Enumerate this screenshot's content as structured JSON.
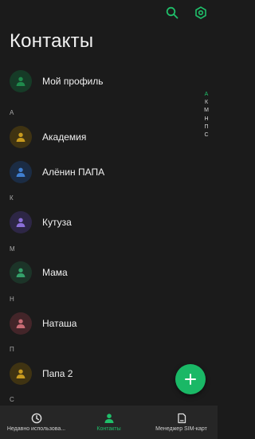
{
  "header": {
    "title": "Контакты",
    "icons": [
      "search-icon",
      "settings-icon"
    ]
  },
  "colors": {
    "accent": "#1fbf6a",
    "background": "#1b1b1b",
    "nav_background": "#262626"
  },
  "my_profile": {
    "label": "Мой профиль",
    "avatar_color": "#1f8a4c",
    "avatar_bg": "#163b27"
  },
  "sections": [
    {
      "letter": "А",
      "contacts": [
        {
          "name": "Академия",
          "avatar_color": "#c79a1e",
          "avatar_bg": "#3f3312"
        },
        {
          "name": "Алёнин ПАПА",
          "avatar_color": "#3f7fd0",
          "avatar_bg": "#1b2c44"
        }
      ]
    },
    {
      "letter": "К",
      "contacts": [
        {
          "name": "Кутуза",
          "avatar_color": "#8b6fd8",
          "avatar_bg": "#2d2645"
        }
      ]
    },
    {
      "letter": "М",
      "contacts": [
        {
          "name": "Мама",
          "avatar_color": "#34a06a",
          "avatar_bg": "#1c3428"
        }
      ]
    },
    {
      "letter": "Н",
      "contacts": [
        {
          "name": "Наташа",
          "avatar_color": "#c86b74",
          "avatar_bg": "#432529"
        }
      ]
    },
    {
      "letter": "П",
      "contacts": [
        {
          "name": "Папа 2",
          "avatar_color": "#c89a1f",
          "avatar_bg": "#3f3312"
        }
      ]
    },
    {
      "letter": "С",
      "contacts": []
    }
  ],
  "index_letters": [
    "А",
    "К",
    "М",
    "Н",
    "П",
    "С"
  ],
  "index_active": "А",
  "fab": {
    "icon": "plus-icon"
  },
  "bottom_nav": [
    {
      "label": "Недавно использова...",
      "icon": "clock-icon",
      "active": false
    },
    {
      "label": "Контакты",
      "icon": "person-icon",
      "active": true
    },
    {
      "label": "Менеджер SIM-карт",
      "icon": "sim-card-icon",
      "active": false
    }
  ]
}
